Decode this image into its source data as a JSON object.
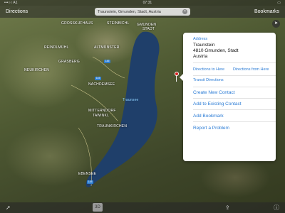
{
  "statusbar": {
    "carrier": "•••○○ A1",
    "time": "07:31"
  },
  "topbar": {
    "left_label": "Directions",
    "right_label": "Bookmarks"
  },
  "search": {
    "value": "Traunstein, Gmunden, Stadt, Austria",
    "clear_icon": "clear-icon"
  },
  "map": {
    "labels": [
      "GROSSKUFHAUS",
      "STEINBICHL",
      "GMUNDEN",
      "STADT",
      "REINDLMÜHL",
      "ALTMÜNSTER",
      "NEUKIRCHEN",
      "GRASBERG",
      "NACHDEMSEE",
      "MITTERNDORF",
      "TAWINKL",
      "TRAUNKIRCHEN",
      "EBENSEE"
    ],
    "lake_label": "Traunsee",
    "road_badges": [
      "145",
      "145",
      "145"
    ]
  },
  "popover": {
    "address_label": "Address",
    "address_lines": [
      "Traunstein",
      "4810 Gmunden, Stadt",
      "Austria"
    ],
    "directions_to": "Directions to Here",
    "directions_from": "Directions from Here",
    "transit_label": "Transit Directions",
    "actions": [
      "Create New Contact",
      "Add to Existing Contact",
      "Add Bookmark",
      "Report a Problem"
    ]
  },
  "bottombar": {
    "mode_3d": "3D"
  },
  "icons": {
    "location": "location-arrow-icon",
    "share": "share-icon",
    "info": "info-icon",
    "compass": "compass-icon"
  }
}
